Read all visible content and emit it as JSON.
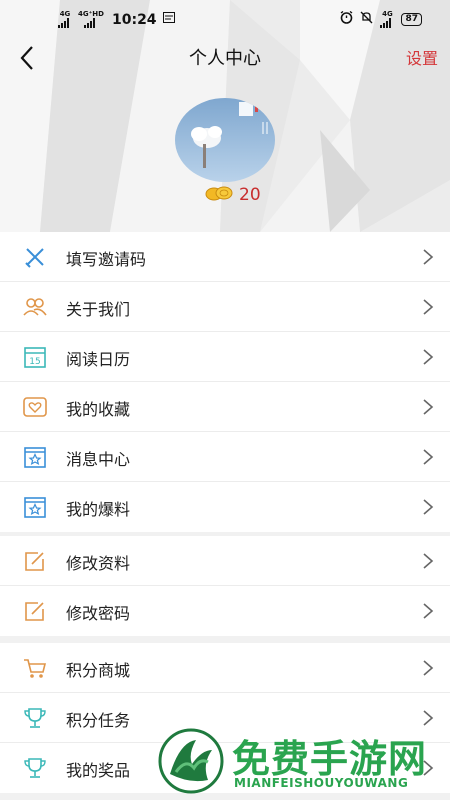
{
  "status_bar": {
    "sim1": "4G",
    "sim2": "4G⁺HD",
    "time": "10:24",
    "right_network": "4G",
    "battery": "87"
  },
  "header": {
    "title": "个人中心",
    "settings_label": "设置",
    "points": "20"
  },
  "menu_groups": [
    {
      "items": [
        {
          "label": "填写邀请码",
          "icon": "pencil-ruler-icon"
        },
        {
          "label": "关于我们",
          "icon": "people-icon"
        },
        {
          "label": "阅读日历",
          "icon": "calendar-icon"
        },
        {
          "label": "我的收藏",
          "icon": "heart-icon"
        },
        {
          "label": "消息中心",
          "icon": "star-box-icon"
        },
        {
          "label": "我的爆料",
          "icon": "star-box-icon"
        }
      ]
    },
    {
      "items": [
        {
          "label": "修改资料",
          "icon": "edit-icon"
        },
        {
          "label": "修改密码",
          "icon": "edit-icon"
        }
      ]
    },
    {
      "items": [
        {
          "label": "积分商城",
          "icon": "cart-icon"
        },
        {
          "label": "积分任务",
          "icon": "trophy-icon"
        },
        {
          "label": "我的奖品",
          "icon": "trophy-icon"
        }
      ]
    }
  ],
  "watermark": {
    "title": "免费手游网",
    "subtitle": "MIANFEISHOUYOUWANG"
  },
  "colors": {
    "accent": "#d4373a",
    "icon_blue": "#3a8fd8",
    "icon_orange": "#e0964a",
    "icon_teal": "#3bb8b8"
  }
}
